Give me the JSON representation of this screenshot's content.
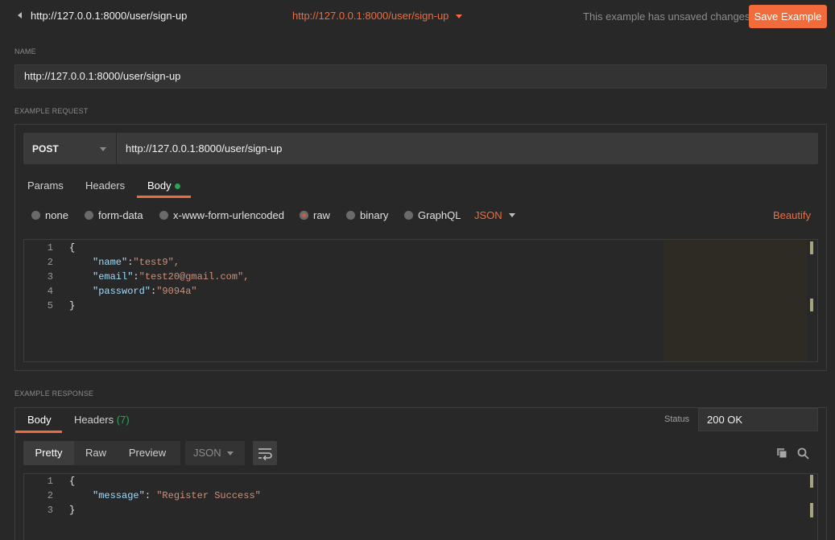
{
  "topbar": {
    "title": "http://127.0.0.1:8000/user/sign-up",
    "request_link": "http://127.0.0.1:8000/user/sign-up",
    "unsaved_text": "This example has unsaved changes",
    "save_label": "Save Example"
  },
  "name_section": {
    "label": "NAME",
    "value": "http://127.0.0.1:8000/user/sign-up"
  },
  "request": {
    "label": "EXAMPLE REQUEST",
    "method": "POST",
    "url": "http://127.0.0.1:8000/user/sign-up",
    "tabs": [
      "Params",
      "Headers",
      "Body"
    ],
    "active_tab": "Body",
    "body_modes": [
      "none",
      "form-data",
      "x-www-form-urlencoded",
      "raw",
      "binary",
      "GraphQL"
    ],
    "selected_mode": "raw",
    "language": "JSON",
    "beautify_label": "Beautify",
    "line_numbers": [
      "1",
      "2",
      "3",
      "4",
      "5"
    ],
    "body": {
      "open": "{",
      "fields": [
        {
          "key": "\"name\"",
          "value": "\"test9\","
        },
        {
          "key": "\"email\"",
          "value": "\"test20@gmail.com\","
        },
        {
          "key": "\"password\"",
          "value": "\"9094a\""
        }
      ],
      "close": "}"
    }
  },
  "response": {
    "label": "EXAMPLE RESPONSE",
    "tabs": [
      "Body",
      "Headers"
    ],
    "headers_count": "(7)",
    "status_label": "Status",
    "status_value": "200 OK",
    "format_buttons": [
      "Pretty",
      "Raw",
      "Preview"
    ],
    "active_format": "Pretty",
    "language": "JSON",
    "line_numbers": [
      "1",
      "2",
      "3"
    ],
    "body": {
      "open": "{",
      "key": "\"message\"",
      "value": "\"Register Success\"",
      "close": "}"
    }
  },
  "colors": {
    "accent": "#f26b3a",
    "background": "#282828",
    "success_dot": "#29a657"
  }
}
